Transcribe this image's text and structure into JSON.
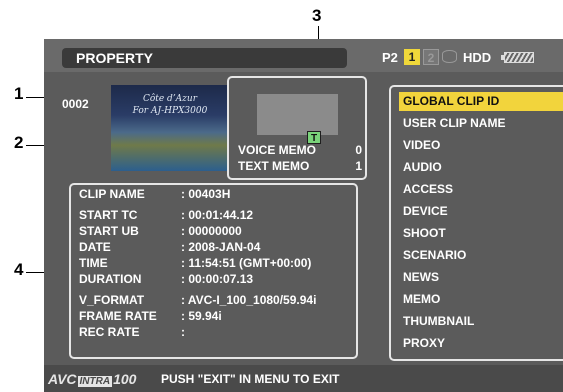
{
  "callouts": {
    "c1": "1",
    "c2": "2",
    "c3": "3",
    "c4": "4"
  },
  "header": {
    "title": "PROPERTY",
    "p2_label": "P2",
    "slot1": "1",
    "slot2": "2",
    "hdd_label": "HDD"
  },
  "clip": {
    "number": "0002"
  },
  "thumbnail": {
    "line1": "Côte d’Azur",
    "line2": "For AJ-HPX3000"
  },
  "memo": {
    "voice_label": "VOICE MEMO",
    "voice_value": "0",
    "text_label": "TEXT MEMO",
    "text_value": "1",
    "text_icon": "T"
  },
  "info": {
    "rows": [
      {
        "key": "CLIP NAME",
        "value": ": 00403H"
      },
      {
        "key": "START TC",
        "value": ": 00:01:44.12"
      },
      {
        "key": "START UB",
        "value": ": 00000000"
      },
      {
        "key": "DATE",
        "value": ": 2008-JAN-04"
      },
      {
        "key": "TIME",
        "value": ": 11:54:51 (GMT+00:00)"
      },
      {
        "key": "DURATION",
        "value": ": 00:00:07.13"
      },
      {
        "key": "V_FORMAT",
        "value": ": AVC-I_100_1080/59.94i"
      },
      {
        "key": "FRAME RATE",
        "value": ": 59.94i"
      },
      {
        "key": "REC RATE",
        "value": ":"
      }
    ]
  },
  "menu": {
    "items": [
      {
        "label": "GLOBAL CLIP ID",
        "selected": true
      },
      {
        "label": "USER CLIP NAME"
      },
      {
        "label": "VIDEO"
      },
      {
        "label": "AUDIO"
      },
      {
        "label": "ACCESS"
      },
      {
        "label": "DEVICE"
      },
      {
        "label": "SHOOT"
      },
      {
        "label": "SCENARIO"
      },
      {
        "label": "NEWS"
      },
      {
        "label": "MEMO"
      },
      {
        "label": "THUMBNAIL"
      },
      {
        "label": "PROXY"
      }
    ]
  },
  "footer": {
    "logo_avc": "AVC",
    "logo_intra": "INTRA",
    "logo_num": "100",
    "message": "PUSH \"EXIT\" IN MENU TO EXIT"
  },
  "colors": {
    "selection": "#f2d43c",
    "slot_active": "#f0d83a",
    "screen_bg": "#5b5b5b",
    "text_icon_bg": "#7ad37a"
  },
  "icons": {
    "hdd": "hdd-icon",
    "battery": "battery-icon",
    "text_memo": "text-memo-icon"
  }
}
